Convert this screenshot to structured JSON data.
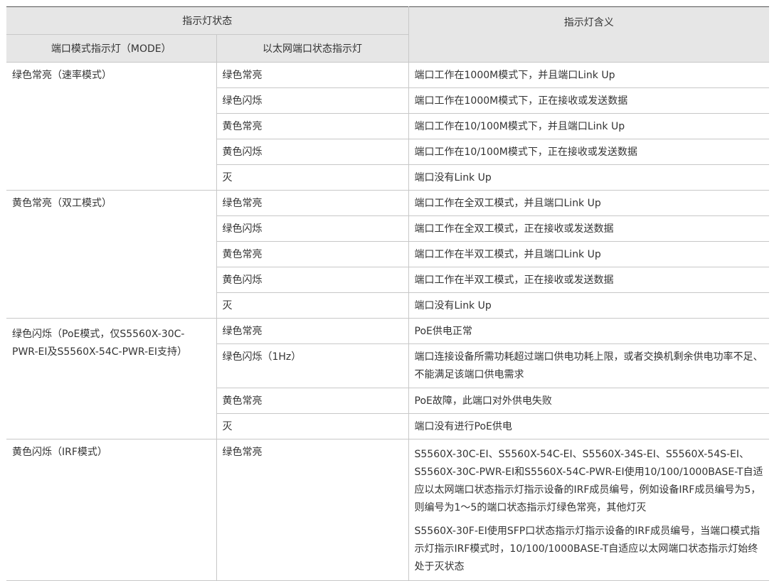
{
  "header": {
    "group_status": "指示灯状态",
    "meaning": "指示灯含义",
    "mode_col": "端口模式指示灯（MODE）",
    "eth_col": "以太网端口状态指示灯"
  },
  "groups": [
    {
      "mode": "绿色常亮（速率模式）",
      "rows": [
        {
          "eth": "绿色常亮",
          "meaning": "端口工作在1000M模式下，并且端口Link Up"
        },
        {
          "eth": "绿色闪烁",
          "meaning": "端口工作在1000M模式下，正在接收或发送数据"
        },
        {
          "eth": "黄色常亮",
          "meaning": "端口工作在10/100M模式下，并且端口Link Up"
        },
        {
          "eth": "黄色闪烁",
          "meaning": "端口工作在10/100M模式下，正在接收或发送数据"
        },
        {
          "eth": "灭",
          "meaning": "端口没有Link Up"
        }
      ]
    },
    {
      "mode": "黄色常亮（双工模式）",
      "rows": [
        {
          "eth": "绿色常亮",
          "meaning": "端口工作在全双工模式，并且端口Link Up"
        },
        {
          "eth": "绿色闪烁",
          "meaning": "端口工作在全双工模式，正在接收或发送数据"
        },
        {
          "eth": "黄色常亮",
          "meaning": "端口工作在半双工模式，并且端口Link Up"
        },
        {
          "eth": "黄色闪烁",
          "meaning": "端口工作在半双工模式，正在接收或发送数据"
        },
        {
          "eth": "灭",
          "meaning": "端口没有Link Up"
        }
      ]
    },
    {
      "mode": "绿色闪烁（PoE模式，仅S5560X-30C-PWR-EI及S5560X-54C-PWR-EI支持）",
      "rows": [
        {
          "eth": "绿色常亮",
          "meaning": "PoE供电正常"
        },
        {
          "eth": "绿色闪烁（1Hz）",
          "meaning": "端口连接设备所需功耗超过端口供电功耗上限，或者交换机剩余供电功率不足、不能满足该端口供电需求"
        },
        {
          "eth": "黄色常亮",
          "meaning": "PoE故障，此端口对外供电失败"
        },
        {
          "eth": "灭",
          "meaning": "端口没有进行PoE供电"
        }
      ]
    },
    {
      "mode": "黄色闪烁（IRF模式）",
      "rows": [
        {
          "eth": "绿色常亮",
          "meaning_p1": "S5560X-30C-EI、S5560X-54C-EI、S5560X-34S-EI、S5560X-54S-EI、S5560X-30C-PWR-EI和S5560X-54C-PWR-EI使用10/100/1000BASE-T自适应以太网端口状态指示灯指示设备的IRF成员编号，例如设备IRF成员编号为5，则编号为1～5的端口状态指示灯绿色常亮，其他灯灭",
          "meaning_p2": "S5560X-30F-EI使用SFP口状态指示灯指示设备的IRF成员编号，当端口模式指示灯指示IRF模式时，10/100/1000BASE-T自适应以太网端口状态指示灯始终处于灭状态"
        }
      ]
    }
  ]
}
